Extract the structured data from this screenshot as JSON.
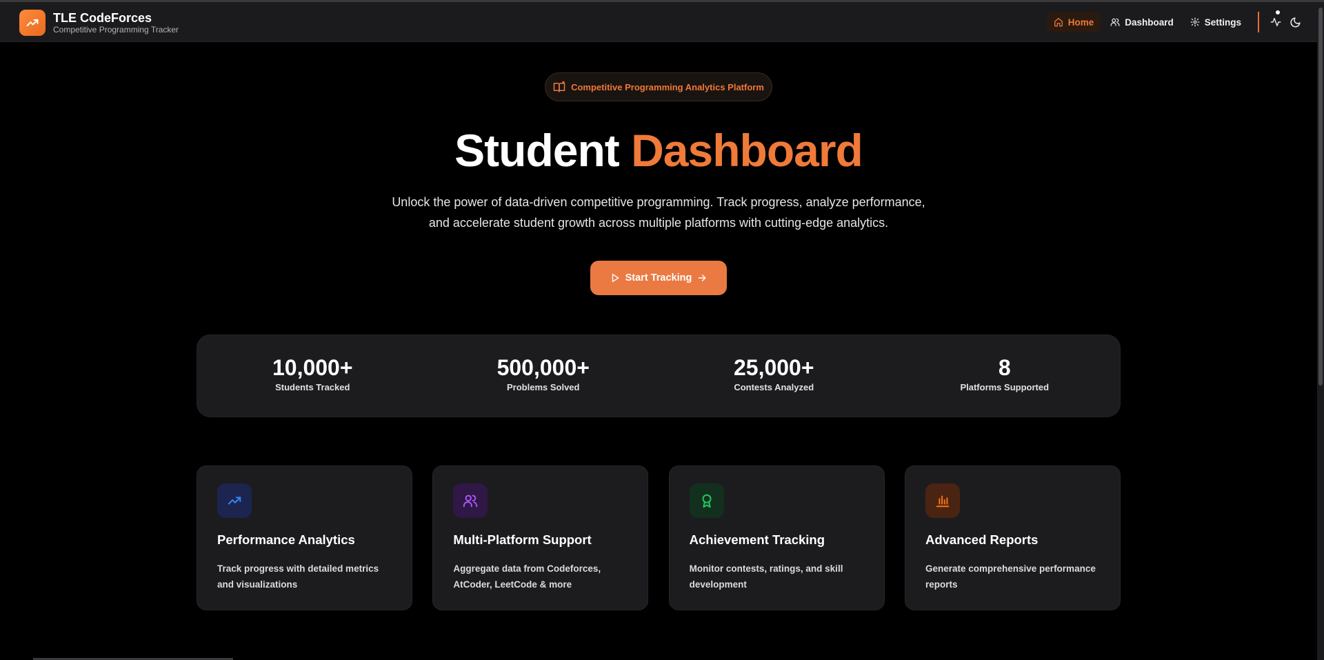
{
  "brand": {
    "title": "TLE CodeForces",
    "subtitle": "Competitive Programming Tracker"
  },
  "nav": {
    "items": [
      {
        "label": "Home",
        "icon": "home-icon",
        "active": true
      },
      {
        "label": "Dashboard",
        "icon": "users-icon",
        "active": false
      },
      {
        "label": "Settings",
        "icon": "gear-icon",
        "active": false
      }
    ],
    "icons": [
      "activity-icon",
      "moon-icon"
    ]
  },
  "hero": {
    "badge": "Competitive Programming Analytics Platform",
    "title_main": "Student",
    "title_accent": "Dashboard",
    "description_line1": "Unlock the power of data-driven competitive programming. Track progress, analyze performance,",
    "description_line2": "and accelerate student growth across multiple platforms with cutting-edge analytics.",
    "cta_label": "Start Tracking"
  },
  "stats": [
    {
      "value": "10,000+",
      "label": "Students Tracked"
    },
    {
      "value": "500,000+",
      "label": "Problems Solved"
    },
    {
      "value": "25,000+",
      "label": "Contests Analyzed"
    },
    {
      "value": "8",
      "label": "Platforms Supported"
    }
  ],
  "features": [
    {
      "title": "Performance Analytics",
      "description": "Track progress with detailed metrics and visualizations",
      "icon": "trending-up-icon",
      "color": "#3b82f6"
    },
    {
      "title": "Multi-Platform Support",
      "description": "Aggregate data from Codeforces, AtCoder, LeetCode & more",
      "icon": "users-icon",
      "color": "#a855f7"
    },
    {
      "title": "Achievement Tracking",
      "description": "Monitor contests, ratings, and skill development",
      "icon": "award-icon",
      "color": "#22c55e"
    },
    {
      "title": "Advanced Reports",
      "description": "Generate comprehensive performance reports",
      "icon": "bar-chart-icon",
      "color": "#f97316"
    }
  ],
  "colors": {
    "accent": "#ef7a3a",
    "background": "#000000",
    "surface": "#1c1c1f"
  }
}
